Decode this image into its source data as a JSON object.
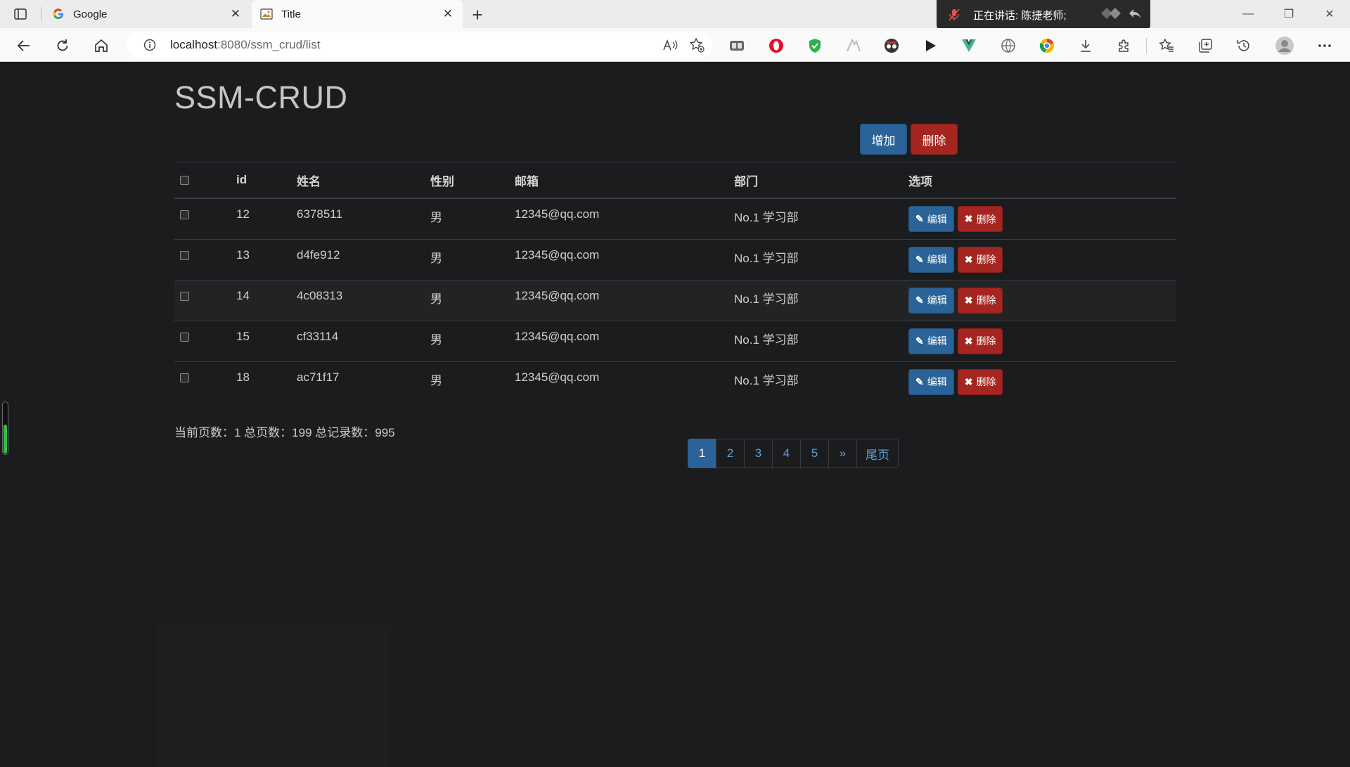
{
  "browser": {
    "tabs": [
      {
        "title": "Google",
        "active": false
      },
      {
        "title": "Title",
        "active": true
      }
    ],
    "new_tab": "+",
    "speaking_banner": "正在讲话: 陈捷老师;",
    "url_host": "localhost",
    "url_rest": ":8080/ssm_crud/list",
    "extensions": [
      "tab-icon",
      "opera-icon",
      "shield-check-icon",
      "leaf-icon",
      "incognito-mask-icon",
      "play-icon",
      "vue-icon",
      "globe-icon",
      "chrome-color-icon",
      "download-icon",
      "puzzle-icon"
    ],
    "accent": "#2a6397"
  },
  "page": {
    "title": "SSM-CRUD",
    "toolbar": {
      "add_label": "增加",
      "delete_label": "删除"
    },
    "table": {
      "headers": [
        "id",
        "姓名",
        "性别",
        "邮箱",
        "部门",
        "选项"
      ],
      "rows": [
        {
          "id": "12",
          "name": "6378511",
          "gender": "男",
          "email": "12345@qq.com",
          "dept": "No.1 学习部"
        },
        {
          "id": "13",
          "name": "d4fe912",
          "gender": "男",
          "email": "12345@qq.com",
          "dept": "No.1 学习部"
        },
        {
          "id": "14",
          "name": "4c08313",
          "gender": "男",
          "email": "12345@qq.com",
          "dept": "No.1 学习部"
        },
        {
          "id": "15",
          "name": "cf33114",
          "gender": "男",
          "email": "12345@qq.com",
          "dept": "No.1 学习部"
        },
        {
          "id": "18",
          "name": "ac71f17",
          "gender": "男",
          "email": "12345@qq.com",
          "dept": "No.1 学习部"
        }
      ],
      "edit_label": "编辑",
      "row_delete_label": "删除"
    },
    "page_info": "当前页数：1 总页数：199 总记录数：995",
    "pagination": {
      "pages": [
        "1",
        "2",
        "3",
        "4",
        "5"
      ],
      "current": "1",
      "next": "»",
      "last": "尾页"
    },
    "side_meter_level": 0.55,
    "colors": {
      "primary": "#2a6397",
      "danger": "#a52620",
      "background": "#1b1c1e"
    }
  }
}
